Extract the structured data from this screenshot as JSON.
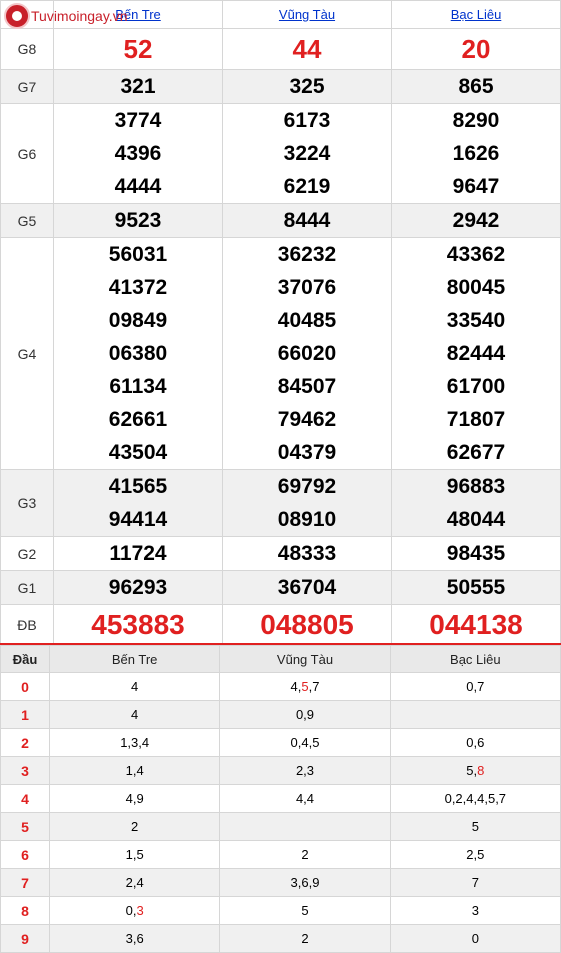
{
  "site": {
    "name": "Tuvimoingay.vn"
  },
  "provinces": [
    "Bến Tre",
    "Vũng Tàu",
    "Bạc Liêu"
  ],
  "prizes": [
    {
      "label": "G8",
      "values": [
        [
          "52"
        ],
        [
          "44"
        ],
        [
          "20"
        ]
      ]
    },
    {
      "label": "G7",
      "values": [
        [
          "321"
        ],
        [
          "325"
        ],
        [
          "865"
        ]
      ]
    },
    {
      "label": "G6",
      "values": [
        [
          "3774",
          "4396",
          "4444"
        ],
        [
          "6173",
          "3224",
          "6219"
        ],
        [
          "8290",
          "1626",
          "9647"
        ]
      ]
    },
    {
      "label": "G5",
      "values": [
        [
          "9523"
        ],
        [
          "8444"
        ],
        [
          "2942"
        ]
      ]
    },
    {
      "label": "G4",
      "values": [
        [
          "56031",
          "41372",
          "09849",
          "06380",
          "61134",
          "62661",
          "43504"
        ],
        [
          "36232",
          "37076",
          "40485",
          "66020",
          "84507",
          "79462",
          "04379"
        ],
        [
          "43362",
          "80045",
          "33540",
          "82444",
          "61700",
          "71807",
          "62677"
        ]
      ]
    },
    {
      "label": "G3",
      "values": [
        [
          "41565",
          "94414"
        ],
        [
          "69792",
          "08910"
        ],
        [
          "96883",
          "48044"
        ]
      ]
    },
    {
      "label": "G2",
      "values": [
        [
          "11724"
        ],
        [
          "48333"
        ],
        [
          "98435"
        ]
      ]
    },
    {
      "label": "G1",
      "values": [
        [
          "96293"
        ],
        [
          "36704"
        ],
        [
          "50555"
        ]
      ]
    },
    {
      "label": "ĐB",
      "values": [
        [
          "453883"
        ],
        [
          "048805"
        ],
        [
          "044138"
        ]
      ]
    }
  ],
  "loto": {
    "header": [
      "Đầu",
      "Bến Tre",
      "Vũng Tàu",
      "Bạc Liêu"
    ],
    "rows": [
      {
        "dau": "0",
        "cells": [
          "4",
          "4,5,7",
          "0,7"
        ]
      },
      {
        "dau": "1",
        "cells": [
          "4",
          "0,9",
          ""
        ]
      },
      {
        "dau": "2",
        "cells": [
          "1,3,4",
          "0,4,5",
          "0,6"
        ]
      },
      {
        "dau": "3",
        "cells": [
          "1,4",
          "2,3",
          "5,8"
        ]
      },
      {
        "dau": "4",
        "cells": [
          "4,9",
          "4,4",
          "0,2,4,4,5,7"
        ]
      },
      {
        "dau": "5",
        "cells": [
          "2",
          "",
          "5"
        ]
      },
      {
        "dau": "6",
        "cells": [
          "1,5",
          "2",
          "2,5"
        ]
      },
      {
        "dau": "7",
        "cells": [
          "2,4",
          "3,6,9",
          "7"
        ]
      },
      {
        "dau": "8",
        "cells": [
          "0,3",
          "5",
          "3"
        ]
      },
      {
        "dau": "9",
        "cells": [
          "3,6",
          "2",
          "0"
        ]
      }
    ],
    "highlights": [
      {
        "row": 0,
        "col": 1,
        "index": 1
      },
      {
        "row": 3,
        "col": 2,
        "index": 1
      },
      {
        "row": 8,
        "col": 0,
        "index": 1
      }
    ]
  },
  "colors": {
    "accent": "#e02020",
    "link": "#0033cc",
    "brand": "#c8202a",
    "stripe": "#f0f0f0"
  }
}
